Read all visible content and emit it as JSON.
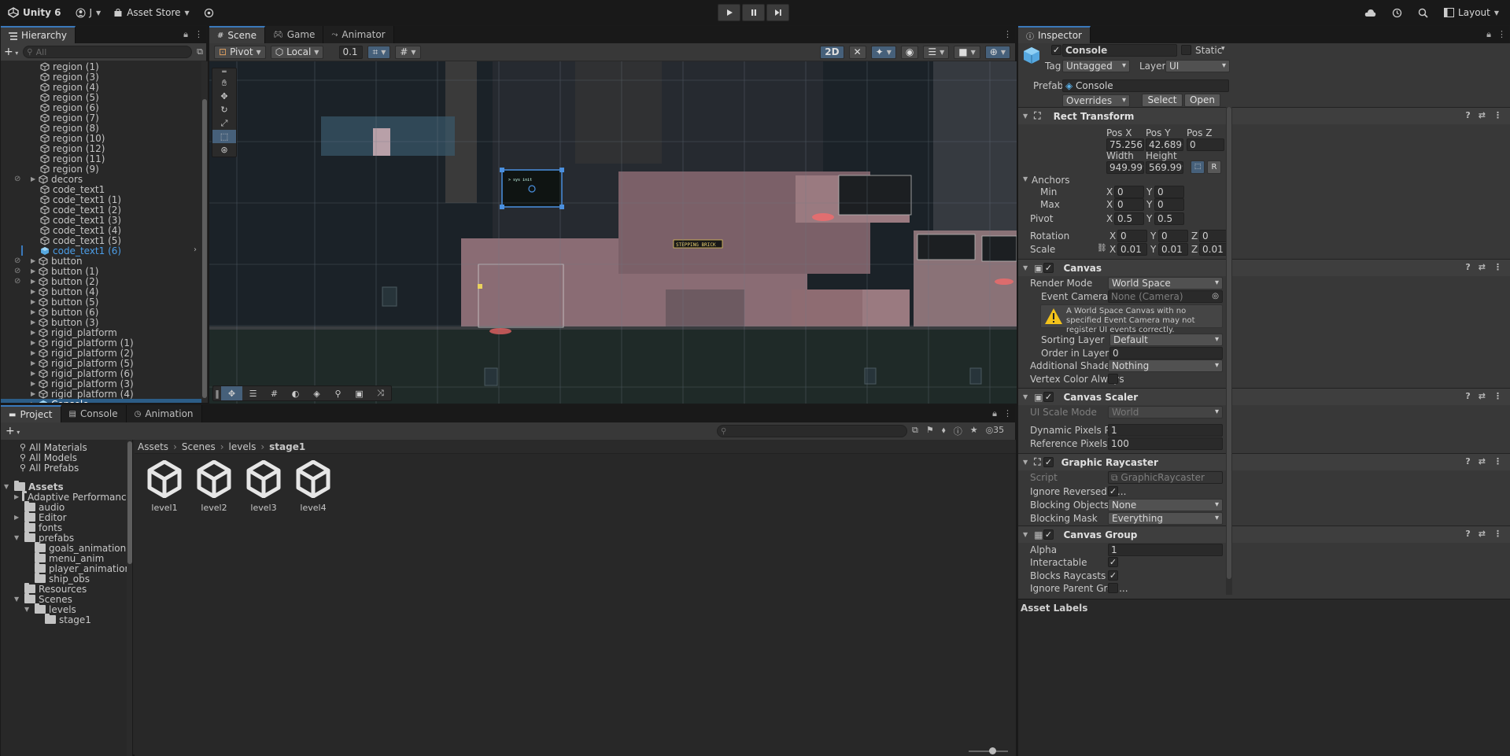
{
  "topbar": {
    "app_title": "Unity 6",
    "account": "J",
    "asset_store": "Asset Store",
    "layout": "Layout"
  },
  "hierarchy": {
    "tab": "Hierarchy",
    "search_placeholder": "All",
    "items": [
      {
        "label": "region (1)",
        "indent": 1,
        "expand": false,
        "state": ""
      },
      {
        "label": "region (3)",
        "indent": 1,
        "expand": false,
        "state": ""
      },
      {
        "label": "region (4)",
        "indent": 1,
        "expand": false,
        "state": ""
      },
      {
        "label": "region (5)",
        "indent": 1,
        "expand": false,
        "state": ""
      },
      {
        "label": "region (6)",
        "indent": 1,
        "expand": false,
        "state": ""
      },
      {
        "label": "region (7)",
        "indent": 1,
        "expand": false,
        "state": ""
      },
      {
        "label": "region (8)",
        "indent": 1,
        "expand": false,
        "state": ""
      },
      {
        "label": "region (10)",
        "indent": 1,
        "expand": false,
        "state": ""
      },
      {
        "label": "region (12)",
        "indent": 1,
        "expand": false,
        "state": ""
      },
      {
        "label": "region (11)",
        "indent": 1,
        "expand": false,
        "state": ""
      },
      {
        "label": "region (9)",
        "indent": 1,
        "expand": false,
        "state": ""
      },
      {
        "label": "decors",
        "indent": 0,
        "expand": true,
        "state": "hidden"
      },
      {
        "label": "code_text1",
        "indent": 1,
        "expand": false,
        "state": ""
      },
      {
        "label": "code_text1 (1)",
        "indent": 1,
        "expand": false,
        "state": ""
      },
      {
        "label": "code_text1 (2)",
        "indent": 1,
        "expand": false,
        "state": ""
      },
      {
        "label": "code_text1 (3)",
        "indent": 1,
        "expand": false,
        "state": ""
      },
      {
        "label": "code_text1 (4)",
        "indent": 1,
        "expand": false,
        "state": ""
      },
      {
        "label": "code_text1 (5)",
        "indent": 1,
        "expand": false,
        "state": ""
      },
      {
        "label": "code_text1 (6)",
        "indent": 1,
        "expand": false,
        "state": "selected"
      },
      {
        "label": "button",
        "indent": 0,
        "expand": true,
        "state": "hidden"
      },
      {
        "label": "button (1)",
        "indent": 0,
        "expand": true,
        "state": "hidden"
      },
      {
        "label": "button (2)",
        "indent": 0,
        "expand": true,
        "state": "hidden"
      },
      {
        "label": "button (4)",
        "indent": 0,
        "expand": true,
        "state": ""
      },
      {
        "label": "button (5)",
        "indent": 0,
        "expand": true,
        "state": ""
      },
      {
        "label": "button (6)",
        "indent": 0,
        "expand": true,
        "state": ""
      },
      {
        "label": "button (3)",
        "indent": 0,
        "expand": true,
        "state": ""
      },
      {
        "label": "rigid_platform",
        "indent": 0,
        "expand": true,
        "state": ""
      },
      {
        "label": "rigid_platform (1)",
        "indent": 0,
        "expand": true,
        "state": ""
      },
      {
        "label": "rigid_platform (2)",
        "indent": 0,
        "expand": true,
        "state": ""
      },
      {
        "label": "rigid_platform (5)",
        "indent": 0,
        "expand": true,
        "state": ""
      },
      {
        "label": "rigid_platform (6)",
        "indent": 0,
        "expand": true,
        "state": ""
      },
      {
        "label": "rigid_platform (3)",
        "indent": 0,
        "expand": true,
        "state": ""
      },
      {
        "label": "rigid_platform (4)",
        "indent": 0,
        "expand": true,
        "state": ""
      },
      {
        "label": "Console",
        "indent": 0,
        "expand": true,
        "state": "console"
      }
    ]
  },
  "scene": {
    "tabs": [
      "Scene",
      "Game",
      "Animator"
    ],
    "pivot": "Pivot",
    "local": "Local",
    "snap_value": "0.1",
    "mode_2d": "2D",
    "sign_text": "STEPPING BRICK"
  },
  "project": {
    "tabs": [
      "Project",
      "Console",
      "Animation"
    ],
    "search_placeholder": "",
    "item_count": "35",
    "favorites": [
      "All Materials",
      "All Models",
      "All Prefabs"
    ],
    "tree": [
      {
        "label": "Assets",
        "level": 0,
        "expand": "open",
        "bold": true
      },
      {
        "label": "Adaptive Performance",
        "level": 1,
        "expand": "closed",
        "bold": false
      },
      {
        "label": "audio",
        "level": 1,
        "expand": "none",
        "bold": false
      },
      {
        "label": "Editor",
        "level": 1,
        "expand": "closed",
        "bold": false
      },
      {
        "label": "fonts",
        "level": 1,
        "expand": "none",
        "bold": false
      },
      {
        "label": "prefabs",
        "level": 1,
        "expand": "open",
        "bold": false
      },
      {
        "label": "goals_animation",
        "level": 2,
        "expand": "none",
        "bold": false
      },
      {
        "label": "menu_anim",
        "level": 2,
        "expand": "none",
        "bold": false
      },
      {
        "label": "player_animation",
        "level": 2,
        "expand": "none",
        "bold": false
      },
      {
        "label": "ship_obs",
        "level": 2,
        "expand": "none",
        "bold": false
      },
      {
        "label": "Resources",
        "level": 1,
        "expand": "none",
        "bold": false
      },
      {
        "label": "Scenes",
        "level": 1,
        "expand": "open",
        "bold": false
      },
      {
        "label": "levels",
        "level": 2,
        "expand": "open",
        "bold": false
      },
      {
        "label": "stage1",
        "level": 3,
        "expand": "none",
        "bold": false
      }
    ],
    "breadcrumb": [
      "Assets",
      "Scenes",
      "levels",
      "stage1"
    ],
    "assets": [
      "level1",
      "level2",
      "level3",
      "level4"
    ]
  },
  "inspector": {
    "tab": "Inspector",
    "object_name": "Console",
    "static_label": "Static",
    "tag_label": "Tag",
    "tag_value": "Untagged",
    "layer_label": "Layer",
    "layer_value": "UI",
    "prefab_label": "Prefab",
    "prefab_value": "Console",
    "overrides": "Overrides",
    "select": "Select",
    "open": "Open",
    "rect_transform": {
      "title": "Rect Transform",
      "posx_label": "Pos X",
      "posy_label": "Pos Y",
      "posz_label": "Pos Z",
      "posx": "75.25675",
      "posy": "42.68961",
      "posz": "0",
      "width_label": "Width",
      "height_label": "Height",
      "width": "949.9999",
      "height": "569.9998",
      "anchors": "Anchors",
      "min": "Min",
      "max": "Max",
      "min_x": "0",
      "min_y": "0",
      "max_x": "0",
      "max_y": "0",
      "pivot": "Pivot",
      "pivot_x": "0.5",
      "pivot_y": "0.5",
      "rotation": "Rotation",
      "rot_x": "0",
      "rot_y": "0",
      "rot_z": "0",
      "scale": "Scale",
      "scale_x": "0.01",
      "scale_y": "0.01",
      "scale_z": "0.01",
      "x": "X",
      "y": "Y",
      "z": "Z",
      "r_btn": "R"
    },
    "canvas": {
      "title": "Canvas",
      "render_mode_label": "Render Mode",
      "render_mode": "World Space",
      "event_camera_label": "Event Camera",
      "event_camera": "None (Camera)",
      "warning": "A World Space Canvas with no specified Event Camera may not register UI events correctly.",
      "sorting_layer_label": "Sorting Layer",
      "sorting_layer": "Default",
      "order_label": "Order in Layer",
      "order": "0",
      "shader_label": "Additional Shader Ch",
      "shader": "Nothing",
      "vertex_label": "Vertex Color Always"
    },
    "canvas_scaler": {
      "title": "Canvas Scaler",
      "scale_mode_label": "UI Scale Mode",
      "scale_mode": "World",
      "dyn_label": "Dynamic Pixels Per U",
      "dyn": "1",
      "ref_label": "Reference Pixels Per",
      "ref": "100"
    },
    "raycaster": {
      "title": "Graphic Raycaster",
      "script_label": "Script",
      "script": "GraphicRaycaster",
      "ignore_label": "Ignore Reversed G...",
      "blocking_objects_label": "Blocking Objects",
      "blocking_objects": "None",
      "blocking_mask_label": "Blocking Mask",
      "blocking_mask": "Everything"
    },
    "canvas_group": {
      "title": "Canvas Group",
      "alpha_label": "Alpha",
      "alpha": "1",
      "interactable_label": "Interactable",
      "blocks_label": "Blocks Raycasts",
      "ignore_parent_label": "Ignore Parent Grou..."
    },
    "asset_labels": "Asset Labels"
  }
}
